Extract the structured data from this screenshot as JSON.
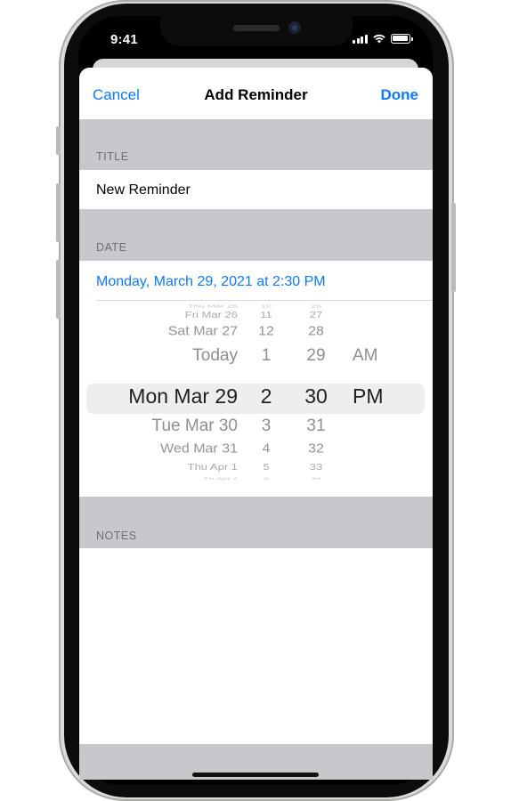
{
  "status": {
    "time": "9:41"
  },
  "navbar": {
    "cancel": "Cancel",
    "title": "Add Reminder",
    "done": "Done"
  },
  "title_section": {
    "header": "TITLE",
    "value": "New Reminder"
  },
  "date_section": {
    "header": "DATE",
    "value": "Monday, March 29, 2021 at 2:30 PM"
  },
  "picker": {
    "dates": [
      "Thu Mar 25",
      "Fri Mar 26",
      "Sat Mar 27",
      "Today",
      "Mon Mar 29",
      "Tue Mar 30",
      "Wed Mar 31",
      "Thu Apr 1",
      "Fri Apr 2"
    ],
    "hours": [
      "10",
      "11",
      "12",
      "1",
      "2",
      "3",
      "4",
      "5",
      "6"
    ],
    "minutes": [
      "26",
      "27",
      "28",
      "29",
      "30",
      "31",
      "32",
      "33",
      "34"
    ],
    "ampm": [
      "AM",
      "PM"
    ],
    "selected_index": 4
  },
  "notes_section": {
    "header": "NOTES",
    "value": ""
  },
  "colors": {
    "accent": "#0a7aff",
    "group_bg": "#c8c8cc",
    "label": "#6d6d72"
  }
}
